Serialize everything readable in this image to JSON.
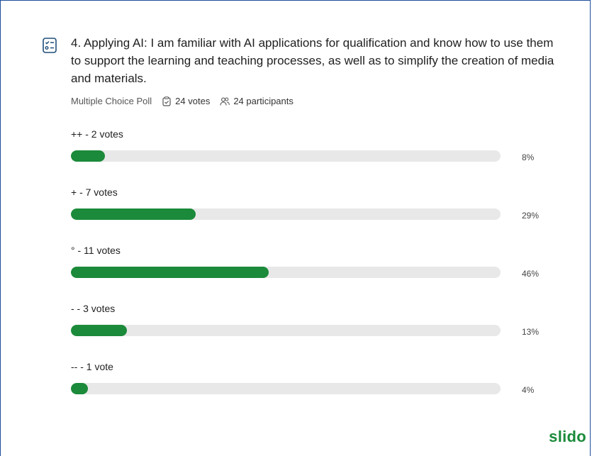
{
  "poll": {
    "title": "4. Applying AI: I am familiar with AI applications for qualification and know how to use them to support the learning and teaching processes, as well as to simplify the creation of media and materials.",
    "type": "Multiple Choice Poll",
    "votes": "24 votes",
    "participants": "24 participants",
    "options": [
      {
        "label": "++ - 2 votes",
        "percent_text": "8%",
        "percent": 8
      },
      {
        "label": "+ - 7 votes",
        "percent_text": "29%",
        "percent": 29
      },
      {
        "label": "° - 11 votes",
        "percent_text": "46%",
        "percent": 46
      },
      {
        "label": "- - 3 votes",
        "percent_text": "13%",
        "percent": 13
      },
      {
        "label": "-- - 1 vote",
        "percent_text": "4%",
        "percent": 4
      }
    ]
  },
  "brand": "slido",
  "colors": {
    "bar": "#1b8a3a",
    "track": "#e8e8e8",
    "frame": "#1c4f9c"
  },
  "icons": {
    "question": "checklist-icon",
    "votes": "clipboard-check-icon",
    "participants": "users-icon"
  }
}
